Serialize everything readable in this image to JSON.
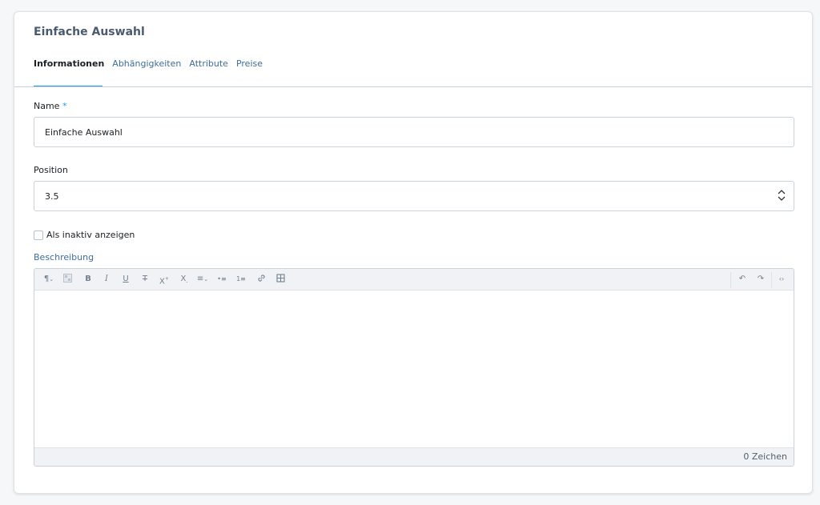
{
  "card": {
    "title": "Einfache Auswahl",
    "tabs": [
      {
        "label": "Informationen",
        "active": true
      },
      {
        "label": "Abhängigkeiten",
        "active": false
      },
      {
        "label": "Attribute",
        "active": false
      },
      {
        "label": "Preise",
        "active": false
      }
    ]
  },
  "form": {
    "name_label": "Name",
    "required_mark": "*",
    "name_value": "Einfache Auswahl",
    "position_label": "Position",
    "position_value": "3.5",
    "inactive_label": "Als inaktiv anzeigen",
    "description_label": "Beschreibung",
    "char_count": "0 Zeichen"
  },
  "toolbar": {
    "paragraph": "¶",
    "bold": "B",
    "italic": "I",
    "underline": "U",
    "strikethrough": "T",
    "superscript": "X",
    "subscript": "X",
    "align": "≡",
    "unordered_list": "•≡",
    "ordered_list": "1≡",
    "link": "🔗",
    "table": "⊞",
    "undo": "↶",
    "redo": "↷",
    "code": "‹›"
  },
  "colors": {
    "accent": "#189eff",
    "link_text": "#3d6e9c"
  }
}
